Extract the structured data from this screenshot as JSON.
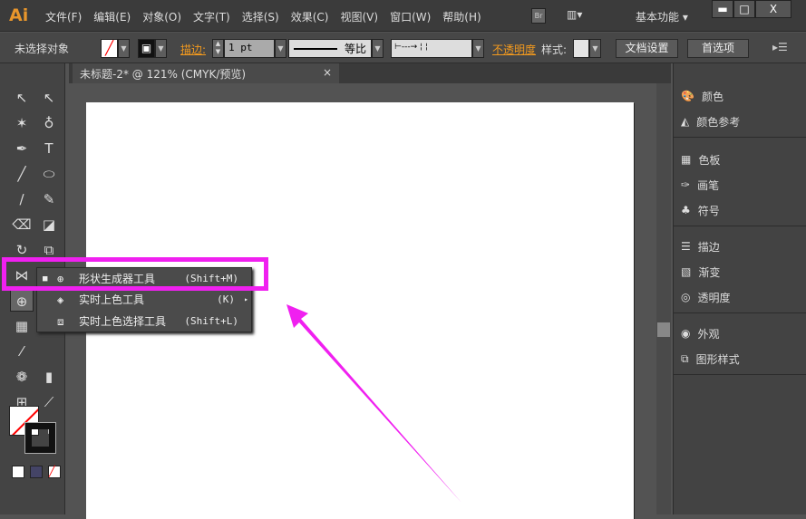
{
  "app": {
    "logo": "Ai",
    "menu": [
      "文件(F)",
      "编辑(E)",
      "对象(O)",
      "文字(T)",
      "选择(S)",
      "效果(C)",
      "视图(V)",
      "窗口(W)",
      "帮助(H)"
    ],
    "bridge": "Br",
    "workspace": "基本功能",
    "win": [
      "▬",
      "□",
      "X"
    ]
  },
  "control": {
    "selection": "未选择对象",
    "stroke_label": "描边:",
    "stroke_value": "1 pt",
    "profile": "等比",
    "opacity_label": "不透明度",
    "style_label": "样式:",
    "doc_setup": "文档设置",
    "prefs": "首选项"
  },
  "document": {
    "tab": "未标题-2* @ 121% (CMYK/预览)",
    "close": "×"
  },
  "panels": [
    [
      "颜色",
      "颜色参考"
    ],
    [
      "色板",
      "画笔",
      "符号"
    ],
    [
      "描边",
      "渐变",
      "透明度"
    ],
    [
      "外观",
      "图形样式"
    ]
  ],
  "flyout": [
    {
      "label": "形状生成器工具",
      "shortcut": "(Shift+M)",
      "selected": true
    },
    {
      "label": "实时上色工具",
      "shortcut": "(K)"
    },
    {
      "label": "实时上色选择工具",
      "shortcut": "(Shift+L)"
    }
  ],
  "colors": {
    "highlight": "#f020f0",
    "accent": "#f39a1e"
  }
}
